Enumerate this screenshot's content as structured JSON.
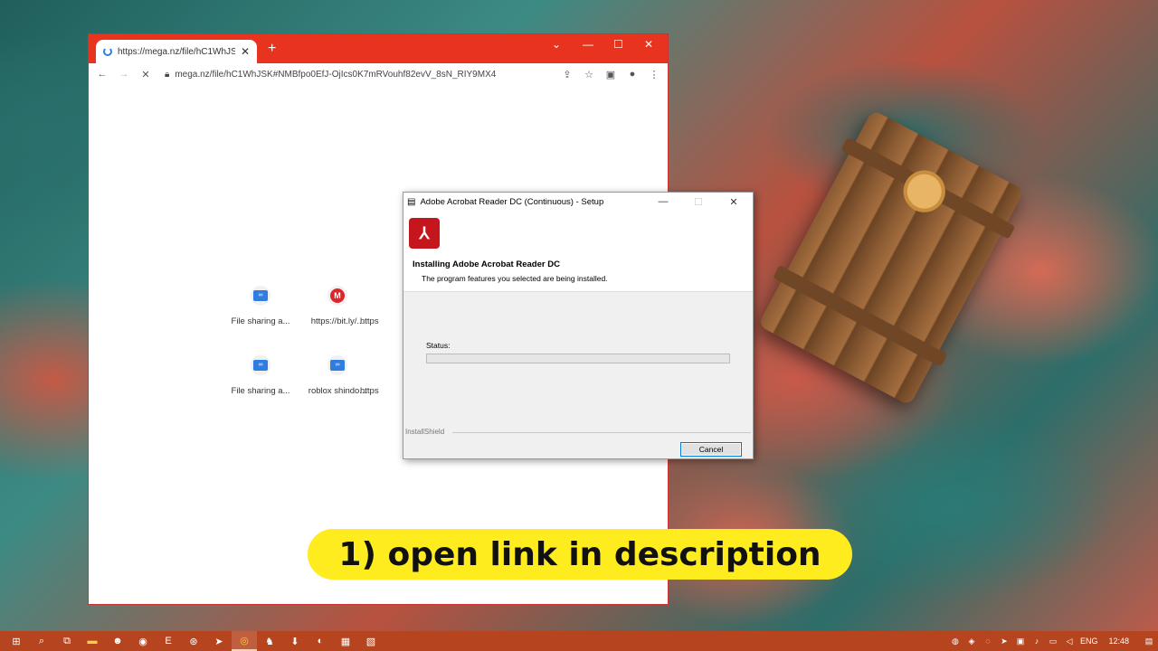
{
  "browser": {
    "tab_title": "https://mega.nz/file/hC1WhJSK#",
    "new_tab": "+",
    "url": "mega.nz/file/hC1WhJSK#NMBfpo0EfJ-OjIcs0K7mRVouhf82evV_8sN_RIY9MX4",
    "shortcuts": [
      {
        "label": "File sharing a...",
        "icon": "mega-cloud-icon"
      },
      {
        "label": "https://bit.ly/...",
        "icon": "mega-m-icon"
      },
      {
        "label": "https",
        "icon": "blank-icon"
      },
      {
        "label": "File sharing a...",
        "icon": "mega-cloud-icon"
      },
      {
        "label": "roblox shindo...",
        "icon": "mega-cloud-icon"
      },
      {
        "label": "https",
        "icon": "blank-icon"
      }
    ]
  },
  "installer": {
    "title": "Adobe Acrobat Reader DC (Continuous) - Setup",
    "heading": "Installing Adobe Acrobat Reader DC",
    "subheading": "The program features you selected are being installed.",
    "status_label": "Status:",
    "progress_fraction": 0,
    "installshield": "InstallShield",
    "cancel": "Cancel"
  },
  "banner": {
    "text": "1) open link in description",
    "color": "#ffec1f"
  },
  "taskbar": {
    "language": "ENG",
    "time": "12:48"
  },
  "colors": {
    "browser_frame": "#e8341f",
    "taskbar": "#b5441f",
    "adobe_red": "#c4161c"
  }
}
